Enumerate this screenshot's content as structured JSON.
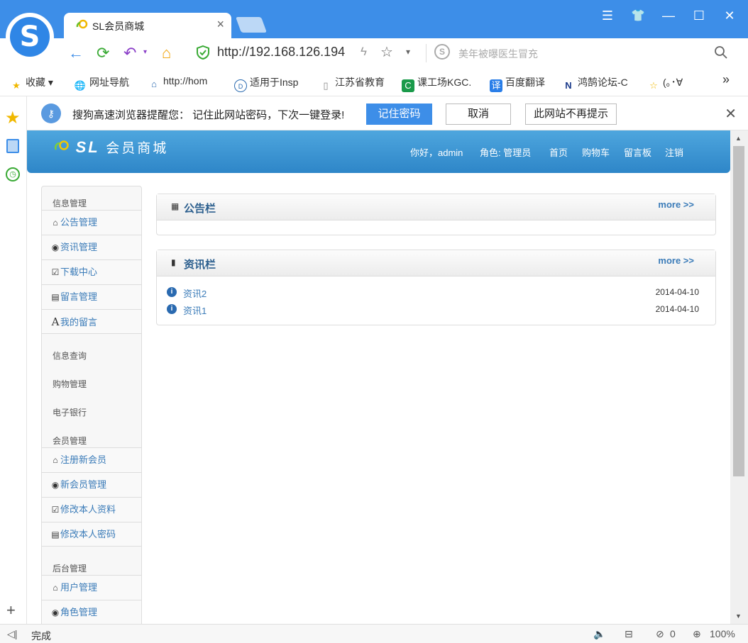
{
  "browser": {
    "tab_title": "SL会员商城",
    "tab_close": "×",
    "url": "http://192.168.126.194",
    "search_placeholder": "美年被曝医生冒充",
    "window_controls": [
      "☰",
      "👕",
      "—",
      "☐",
      "✕"
    ]
  },
  "bookmarks": [
    {
      "icon": "star-icon",
      "label": "收藏 ▾"
    },
    {
      "icon": "globe-icon",
      "label": "网址导航"
    },
    {
      "icon": "home-page-icon",
      "label": "http://hom"
    },
    {
      "icon": "dell-icon",
      "label": "适用于Insp"
    },
    {
      "icon": "page-icon",
      "label": "江苏省教育"
    },
    {
      "icon": "kgc-icon",
      "label": "课工场KGC."
    },
    {
      "icon": "translate-icon",
      "label": "百度翻译"
    },
    {
      "icon": "forum-icon",
      "label": "鸿鹄论坛-C"
    },
    {
      "icon": "star-icon",
      "label": "(｡･∀"
    }
  ],
  "bookmarks_more": "»",
  "notice": {
    "message": "搜狗高速浏览器提醒您：  记住此网站密码，下次一键登录!",
    "remember": "记住密码",
    "cancel": "取消",
    "never": "此网站不再提示",
    "close": "✕"
  },
  "site": {
    "logo_sl": "SL",
    "logo_text": "会员商城",
    "greeting": "你好，admin",
    "role": "角色: 管理员",
    "nav": [
      "首页",
      "购物车",
      "留言板",
      "注销"
    ]
  },
  "menu": {
    "group_info": "信息管理",
    "info_items": [
      "公告管理",
      "资讯管理",
      "下载中心",
      "留言管理",
      "我的留言"
    ],
    "group_query": "信息查询",
    "group_shopping": "购物管理",
    "group_bank": "电子银行",
    "group_member": "会员管理",
    "member_items": [
      "注册新会员",
      "新会员管理",
      "修改本人资料",
      "修改本人密码"
    ],
    "group_admin": "后台管理",
    "admin_items": [
      "用户管理",
      "角色管理"
    ]
  },
  "panels": {
    "notice_title": "公告栏",
    "news_title": "资讯栏",
    "more": "more >>",
    "news": [
      {
        "title": "资讯2",
        "date": "2014-04-10"
      },
      {
        "title": "资讯1",
        "date": "2014-04-10"
      }
    ]
  },
  "status": {
    "text": "完成",
    "adblock_count": "0",
    "zoom": "100%"
  },
  "colors": {
    "titlebar": "#3d8ee8",
    "header": "#2e86c8",
    "link": "#3a7bb8"
  }
}
